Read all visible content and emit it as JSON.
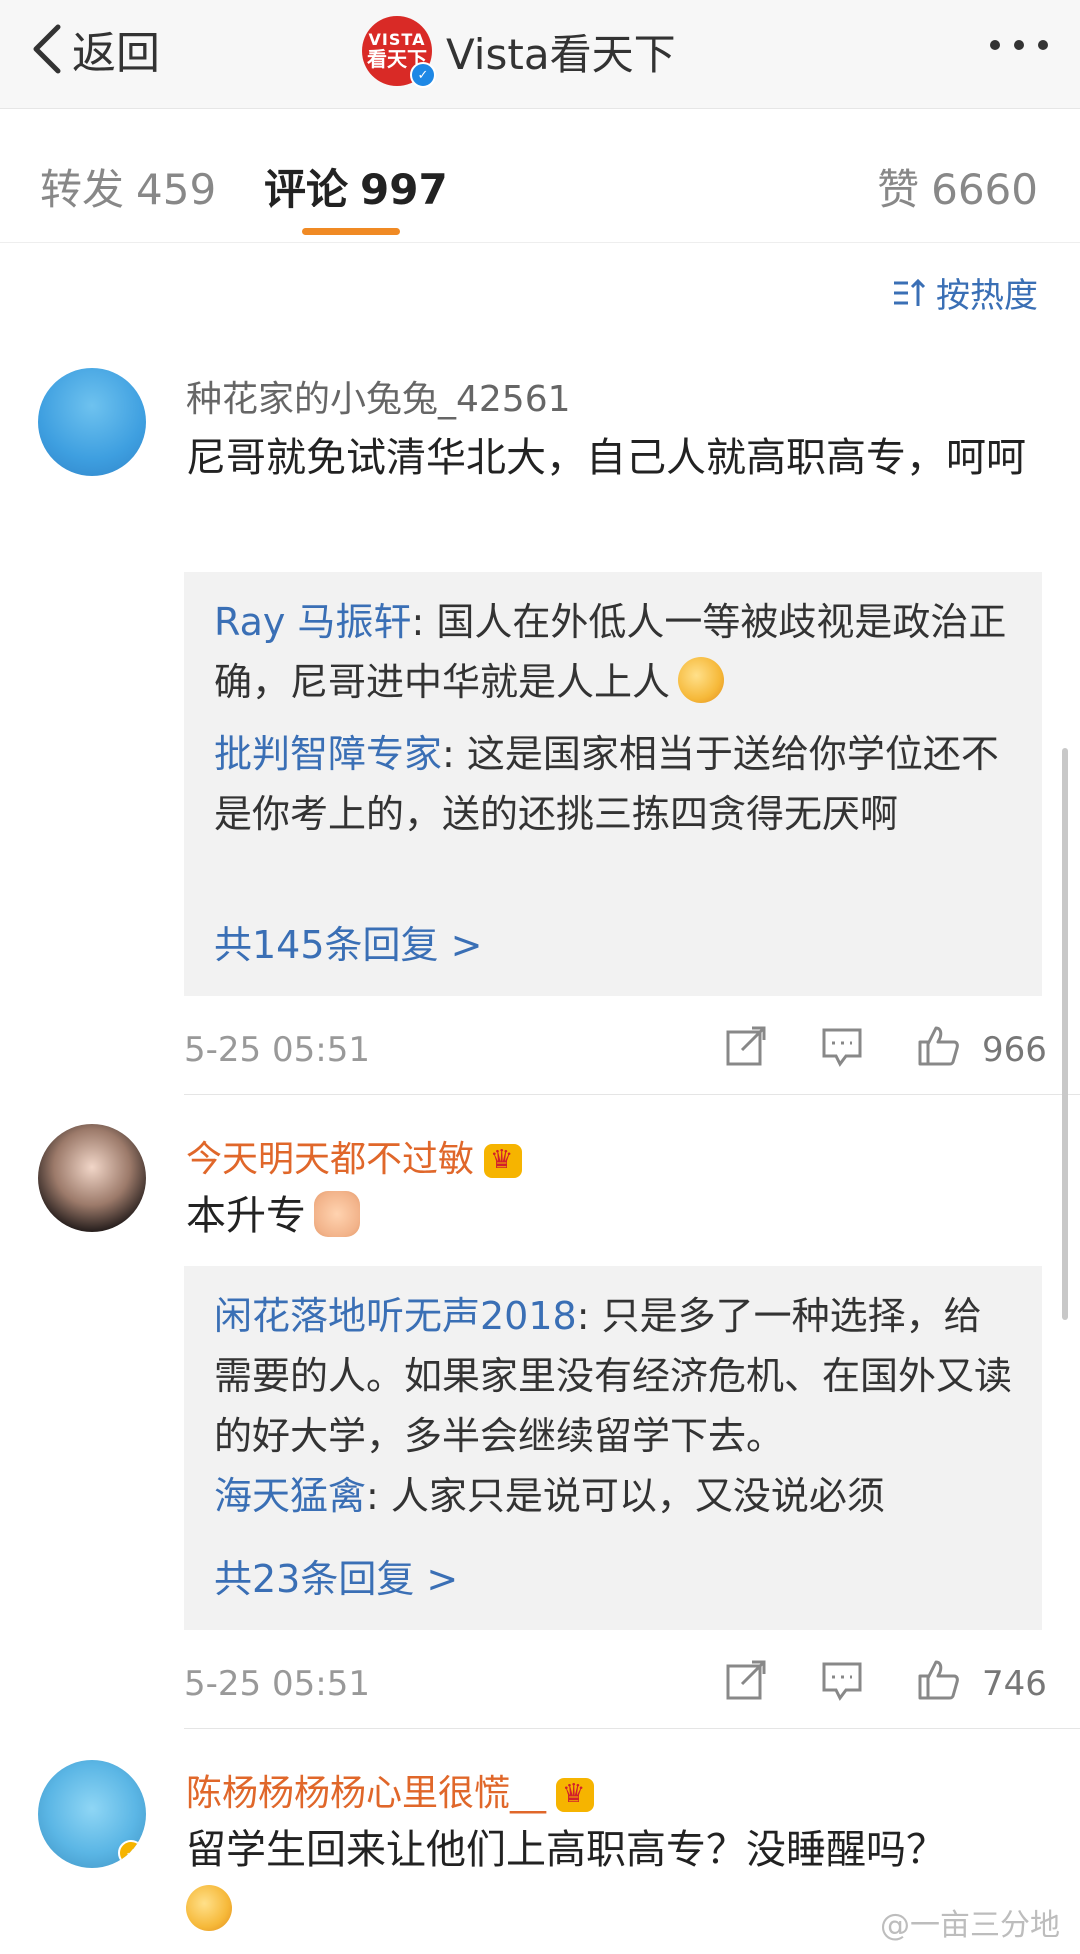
{
  "topbar": {
    "back_label": "返回",
    "logo_line1": "VISTA",
    "logo_line2": "看天下",
    "title": "Vista看天下"
  },
  "tabs": {
    "repost_label": "转发",
    "repost_count": "459",
    "comment_label": "评论",
    "comment_count": "997",
    "like_label": "赞",
    "like_count": "6660"
  },
  "sort_label": "按热度",
  "comments": [
    {
      "username": "种花家的小兔兔_42561",
      "text": "尼哥就免试清华北大，自己人就高职高专，呵呵",
      "replies": [
        {
          "name": "Ray 马振轩",
          "text": ": 国人在外低人一等被歧视是政治正确，尼哥进中华就是人上人"
        },
        {
          "name": "批判智障专家",
          "text": ": 这是国家相当于送给你学位还不是你考上的，送的还挑三拣四贪得无厌啊"
        }
      ],
      "more_replies": "共145条回复 >",
      "time": "5-25 05:51",
      "likes": "966"
    },
    {
      "username": "今天明天都不过敏",
      "text": "本升专",
      "replies": [
        {
          "name": "闲花落地听无声2018",
          "text": ": 只是多了一种选择，给需要的人。如果家里没有经济危机、在国外又读的好大学，多半会继续留学下去。"
        },
        {
          "name": "海天猛禽",
          "text": ": 人家只是说可以，又没说必须"
        }
      ],
      "more_replies": "共23条回复 >",
      "time": "5-25 05:51",
      "likes": "746"
    },
    {
      "username": "陈杨杨杨杨心里很慌__",
      "text": "留学生回来让他们上高职高专？没睡醒吗？"
    }
  ],
  "watermark": "@一亩三分地",
  "colors": {
    "accent_orange": "#f08a24",
    "link_blue": "#3a6fb5",
    "vip_orange": "#e0672a"
  }
}
